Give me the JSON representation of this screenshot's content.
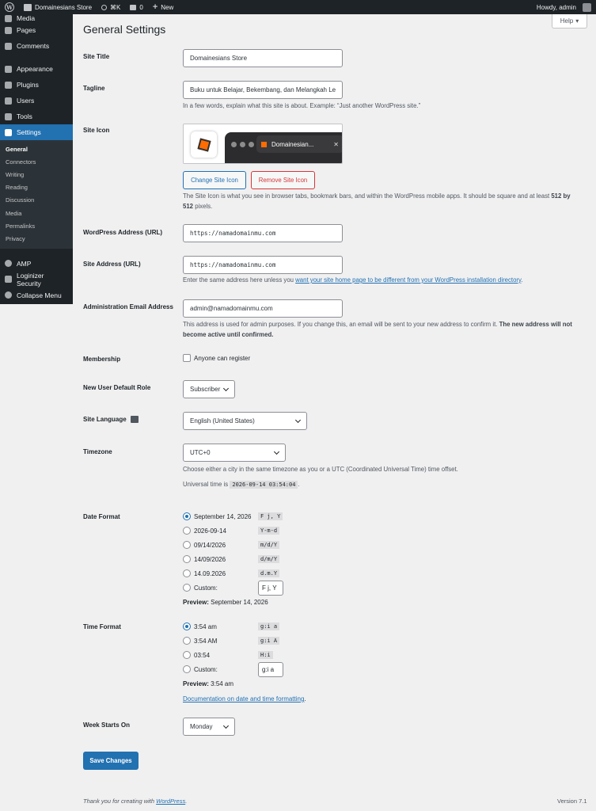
{
  "adminbar": {
    "site_name": "Domainesians Store",
    "shortcut": "⌘K",
    "comments_count": "0",
    "new_label": "New",
    "greeting": "Howdy, admin"
  },
  "sidebar": {
    "items_top": [
      {
        "label": "Media"
      },
      {
        "label": "Pages"
      },
      {
        "label": "Comments"
      }
    ],
    "items_mid": [
      {
        "label": "Appearance"
      },
      {
        "label": "Plugins"
      },
      {
        "label": "Users"
      },
      {
        "label": "Tools"
      },
      {
        "label": "Settings"
      }
    ],
    "submenu": [
      "General",
      "Connectors",
      "Writing",
      "Reading",
      "Discussion",
      "Media",
      "Permalinks",
      "Privacy"
    ],
    "items_bottom": [
      {
        "label": "AMP"
      },
      {
        "label": "Loginizer Security"
      },
      {
        "label": "Collapse Menu"
      }
    ]
  },
  "help_label": "Help",
  "page_title": "General Settings",
  "site_title": {
    "label": "Site Title",
    "value": "Domainesians Store"
  },
  "tagline": {
    "label": "Tagline",
    "value": "Buku untuk Belajar, Bekembang, dan Melangkah Le",
    "desc": "In a few words, explain what this site is about. Example: “Just another WordPress site.”"
  },
  "site_icon": {
    "label": "Site Icon",
    "tab_title": "Domainesian...",
    "change_label": "Change Site Icon",
    "remove_label": "Remove Site Icon",
    "desc_1": "The Site Icon is what you see in browser tabs, bookmark bars, and within the WordPress mobile apps. It should be square and at least",
    "desc_bold": "512 by 512",
    "desc_2": "pixels."
  },
  "wp_address": {
    "label": "WordPress Address (URL)",
    "value": "https://namadomainmu.com"
  },
  "site_address": {
    "label": "Site Address (URL)",
    "value": "https://namadomainmu.com",
    "desc_pre": "Enter the same address here unless you",
    "desc_link": "want your site home page to be different from your WordPress installation directory",
    "desc_post": "."
  },
  "admin_email": {
    "label": "Administration Email Address",
    "value": "admin@namadomainmu.com",
    "desc_1": "This address is used for admin purposes. If you change this, an email will be sent to your new address to confirm it.",
    "desc_bold": "The new address will not become active until confirmed."
  },
  "membership": {
    "label": "Membership",
    "option": "Anyone can register"
  },
  "default_role": {
    "label": "New User Default Role",
    "value": "Subscriber"
  },
  "site_language": {
    "label": "Site Language",
    "value": "English (United States)"
  },
  "timezone": {
    "label": "Timezone",
    "value": "UTC+0",
    "desc": "Choose either a city in the same timezone as you or a UTC (Coordinated Universal Time) time offset.",
    "universal_label": "Universal time is",
    "universal_value": "2026-09-14 03:54:04",
    "universal_end": "."
  },
  "date_format": {
    "label": "Date Format",
    "options": [
      {
        "text": "September 14, 2026",
        "code": "F j, Y",
        "checked": true
      },
      {
        "text": "2026-09-14",
        "code": "Y-m-d",
        "checked": false
      },
      {
        "text": "09/14/2026",
        "code": "m/d/Y",
        "checked": false
      },
      {
        "text": "14/09/2026",
        "code": "d/m/Y",
        "checked": false
      },
      {
        "text": "14.09.2026",
        "code": "d.m.Y",
        "checked": false
      }
    ],
    "custom_label": "Custom:",
    "custom_value": "F j, Y",
    "preview_label": "Preview:",
    "preview_value": "September 14, 2026"
  },
  "time_format": {
    "label": "Time Format",
    "options": [
      {
        "text": "3:54 am",
        "code": "g:i a",
        "checked": true
      },
      {
        "text": "3:54 AM",
        "code": "g:i A",
        "checked": false
      },
      {
        "text": "03:54",
        "code": "H:i",
        "checked": false
      }
    ],
    "custom_label": "Custom:",
    "custom_value": "g:i a",
    "preview_label": "Preview:",
    "preview_value": "3:54 am",
    "doc_link": "Documentation on date and time formatting",
    "doc_end": "."
  },
  "week_start": {
    "label": "Week Starts On",
    "value": "Monday"
  },
  "save_label": "Save Changes",
  "footer": {
    "left_pre": "Thank you for creating with",
    "left_link": "WordPress",
    "left_end": ".",
    "version": "Version 7.1"
  },
  "colors": {
    "accent": "#2271b1",
    "sidebar_bg": "#1d2327",
    "danger": "#d63638"
  }
}
